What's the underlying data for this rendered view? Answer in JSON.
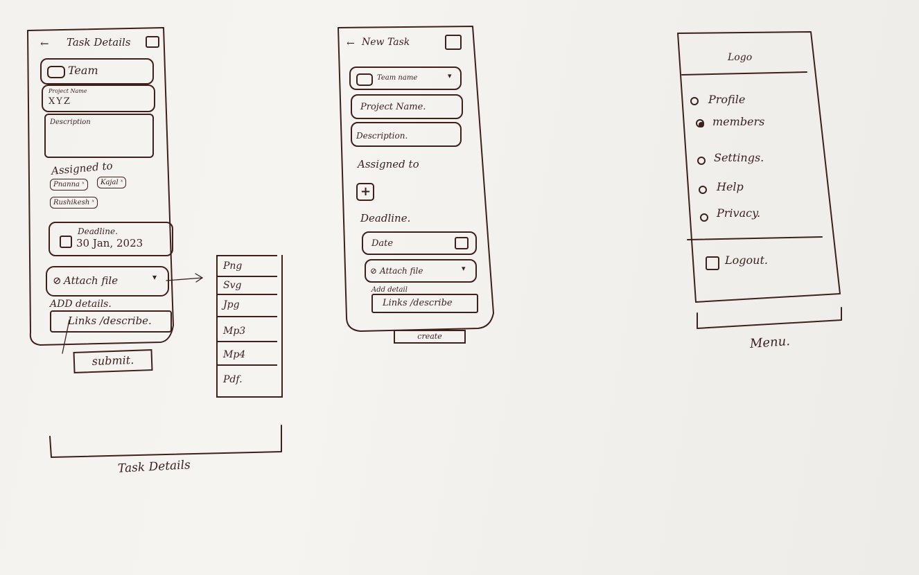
{
  "task_details": {
    "back_arrow": "←",
    "header_title": "Task Details",
    "team_label": "Team",
    "project_caption": "Project Name",
    "project_value": "XYZ",
    "description_label": "Description",
    "assigned_label": "Assigned to",
    "assignees": [
      "Pnanna ˣ",
      "Kajal ˣ",
      "Rushikesh ˣ"
    ],
    "deadline_label": "Deadline.",
    "deadline_date": "30 Jan, 2023",
    "attach_label": "Attach file",
    "add_details_label": "ADD details.",
    "links_label": "Links /describe.",
    "submit_label": "submit.",
    "screen_caption": "Task Details"
  },
  "file_types": [
    "Png",
    "Svg",
    "Jpg",
    "Mp3",
    "Mp4",
    "Pdf."
  ],
  "new_task": {
    "back_arrow": "←",
    "header_title": "New Task",
    "team_select": "Team name",
    "project_placeholder": "Project Name.",
    "description_placeholder": "Description.",
    "assigned_label": "Assigned to",
    "add_symbol": "+",
    "deadline_label": "Deadline.",
    "date_placeholder": "Date",
    "attach_label": "Attach file",
    "add_details_label": "Add detail",
    "links_label": "Links /describe",
    "create_label": "create"
  },
  "menu": {
    "logo_label": "Logo",
    "items": [
      "Profile",
      "members",
      "Settings.",
      "Help",
      "Privacy."
    ],
    "logout_label": "Logout.",
    "screen_caption": "Menu."
  }
}
